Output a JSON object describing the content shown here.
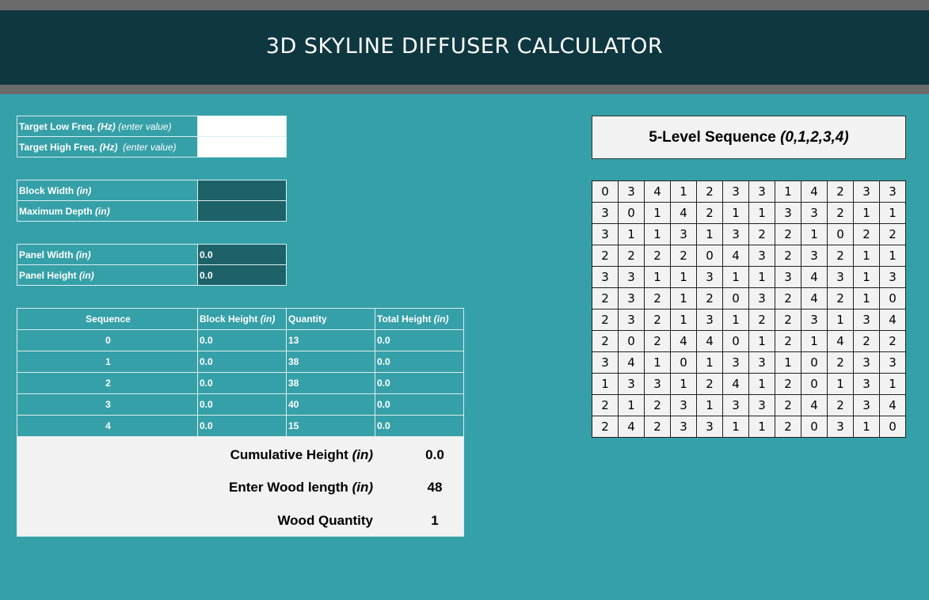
{
  "title": "3D SKYLINE DIFFUSER CALCULATOR",
  "freq": {
    "low_label": "Target Low Freq.",
    "low_unit": "(Hz)",
    "low_note": "(enter value)",
    "low_value": "",
    "high_label": "Target High Freq.",
    "high_unit": "(Hz)",
    "high_note": "(enter value)",
    "high_value": ""
  },
  "block": {
    "width_label": "Block Width",
    "width_unit": "(in)",
    "width_value": "",
    "depth_label": "Maximum Depth",
    "depth_unit": "(in)",
    "depth_value": ""
  },
  "panel": {
    "width_label": "Panel Width",
    "width_unit": "(in)",
    "width_value": "0.0",
    "height_label": "Panel Height",
    "height_unit": "(in)",
    "height_value": "0.0"
  },
  "results": {
    "headers": {
      "sequence": "Sequence",
      "block_height": "Block Height",
      "block_height_unit": "(in)",
      "quantity": "Quantity",
      "total_height": "Total Height",
      "total_height_unit": "(in)"
    },
    "rows": [
      {
        "sequence": "0",
        "block_height": "0.0",
        "quantity": "13",
        "total_height": "0.0"
      },
      {
        "sequence": "1",
        "block_height": "0.0",
        "quantity": "38",
        "total_height": "0.0"
      },
      {
        "sequence": "2",
        "block_height": "0.0",
        "quantity": "38",
        "total_height": "0.0"
      },
      {
        "sequence": "3",
        "block_height": "0.0",
        "quantity": "40",
        "total_height": "0.0"
      },
      {
        "sequence": "4",
        "block_height": "0.0",
        "quantity": "15",
        "total_height": "0.0"
      }
    ]
  },
  "summary": {
    "cumulative_label": "Cumulative Height",
    "cumulative_unit": "(in)",
    "cumulative_value": "0.0",
    "wood_length_label": "Enter Wood length",
    "wood_length_unit": "(in)",
    "wood_length_value": "48",
    "wood_qty_label": "Wood Quantity",
    "wood_qty_value": "1"
  },
  "sequence_panel": {
    "title": "5-Level Sequence",
    "levels": "(0,1,2,3,4)",
    "matrix": [
      [
        0,
        3,
        4,
        1,
        2,
        3,
        3,
        1,
        4,
        2,
        3,
        3
      ],
      [
        3,
        0,
        1,
        4,
        2,
        1,
        1,
        3,
        3,
        2,
        1,
        1
      ],
      [
        3,
        1,
        1,
        3,
        1,
        3,
        2,
        2,
        1,
        0,
        2,
        2
      ],
      [
        2,
        2,
        2,
        2,
        0,
        4,
        3,
        2,
        3,
        2,
        1,
        1
      ],
      [
        3,
        3,
        1,
        1,
        3,
        1,
        1,
        3,
        4,
        3,
        1,
        3
      ],
      [
        2,
        3,
        2,
        1,
        2,
        0,
        3,
        2,
        4,
        2,
        1,
        0
      ],
      [
        2,
        3,
        2,
        1,
        3,
        1,
        2,
        2,
        3,
        1,
        3,
        4
      ],
      [
        2,
        0,
        2,
        4,
        4,
        0,
        1,
        2,
        1,
        4,
        2,
        2
      ],
      [
        3,
        4,
        1,
        0,
        1,
        3,
        3,
        1,
        0,
        2,
        3,
        3
      ],
      [
        1,
        3,
        3,
        1,
        2,
        4,
        1,
        2,
        0,
        1,
        3,
        1
      ],
      [
        2,
        1,
        2,
        3,
        1,
        3,
        3,
        2,
        4,
        2,
        3,
        4
      ],
      [
        2,
        4,
        2,
        3,
        3,
        1,
        1,
        2,
        0,
        3,
        1,
        0
      ]
    ]
  },
  "colors": {
    "background": "#36a0a8",
    "header": "#0e3740",
    "dark_input": "#1d6268",
    "bar": "#6b6b6b"
  }
}
